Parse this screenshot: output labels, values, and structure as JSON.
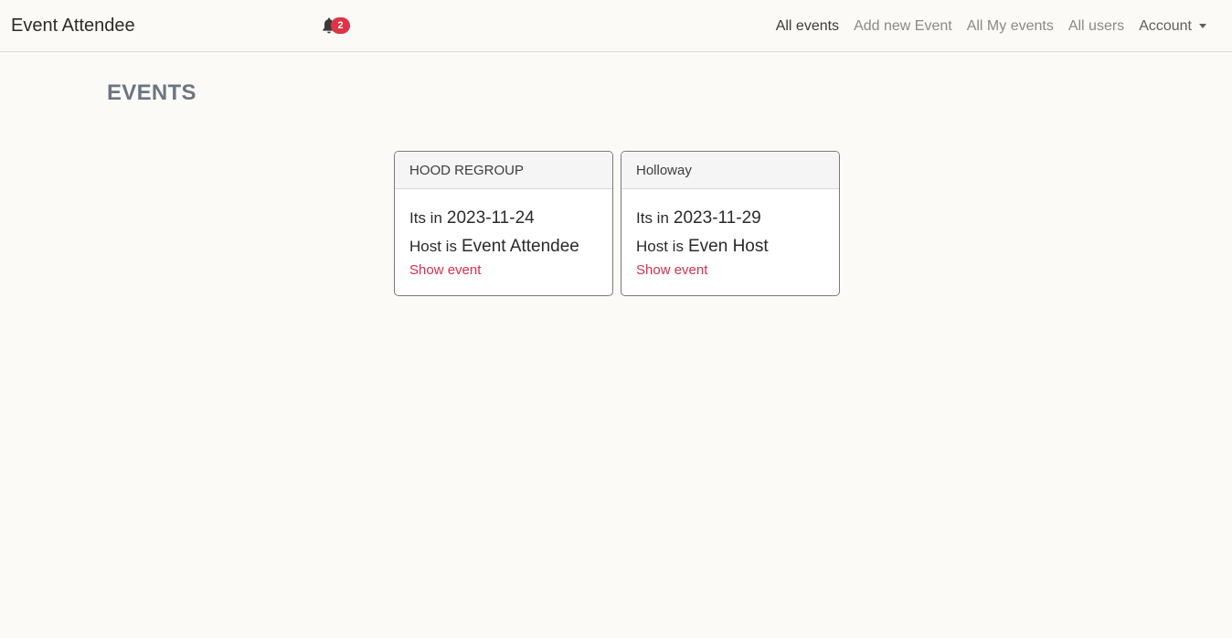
{
  "navbar": {
    "brand": "Event Attendee",
    "notification_count": "2",
    "links": [
      {
        "label": "All events",
        "active": true
      },
      {
        "label": "Add new Event",
        "active": false
      },
      {
        "label": "All My events",
        "active": false
      },
      {
        "label": "All users",
        "active": false
      }
    ],
    "account_label": "Account"
  },
  "main": {
    "title": "EVENTS",
    "events": [
      {
        "name": "HOOD REGROUP",
        "date_prefix": "Its in",
        "date": "2023-11-24",
        "host_prefix": "Host is",
        "host": "Event Attendee",
        "link_label": "Show event"
      },
      {
        "name": "Holloway",
        "date_prefix": "Its in",
        "date": "2023-11-29",
        "host_prefix": "Host is",
        "host": "Even Host",
        "link_label": "Show event"
      }
    ]
  },
  "colors": {
    "background": "#fbfaf7",
    "badge": "#dc3545",
    "link": "#d6304d",
    "title": "#6b7682"
  },
  "icons": {
    "notification": "bell-icon",
    "account_caret": "caret-down-icon"
  }
}
